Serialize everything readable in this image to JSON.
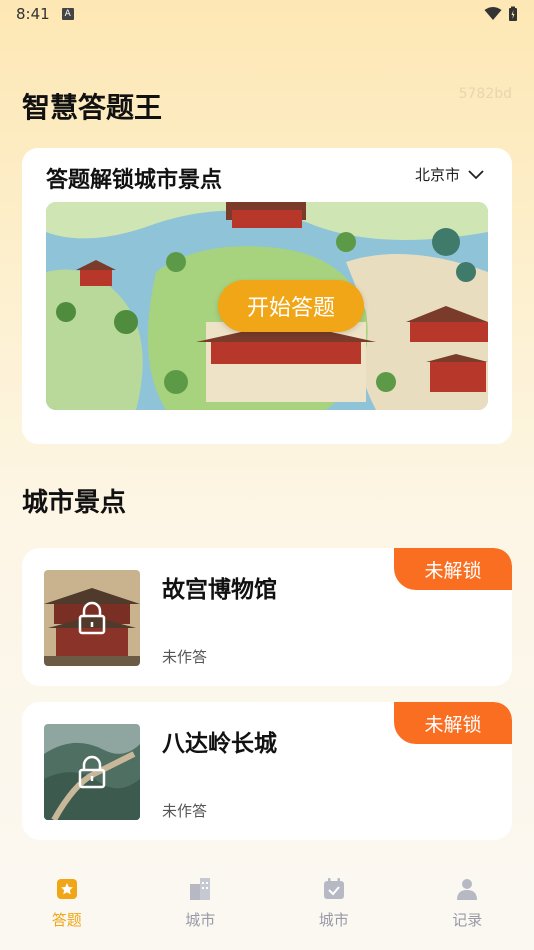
{
  "status_bar": {
    "time": "8:41"
  },
  "header": {
    "title": "智慧答题王",
    "build_tag": "5782bd"
  },
  "quiz_card": {
    "title": "答题解锁城市景点",
    "city_selector": "北京市",
    "start_button": "开始答题"
  },
  "section": {
    "title": "城市景点"
  },
  "spots": [
    {
      "name": "故宫博物馆",
      "status": "未作答",
      "badge": "未解锁"
    },
    {
      "name": "八达岭长城",
      "status": "未作答",
      "badge": "未解锁"
    }
  ],
  "tabs": [
    {
      "label": "答题",
      "icon": "star-icon",
      "active": true
    },
    {
      "label": "城市",
      "icon": "building-icon",
      "active": false
    },
    {
      "label": "城市",
      "icon": "calendar-check-icon",
      "active": false
    },
    {
      "label": "记录",
      "icon": "person-icon",
      "active": false
    }
  ],
  "colors": {
    "accent": "#f0a617",
    "badge": "#fa6e21",
    "tab_inactive": "#9a9aa6"
  }
}
